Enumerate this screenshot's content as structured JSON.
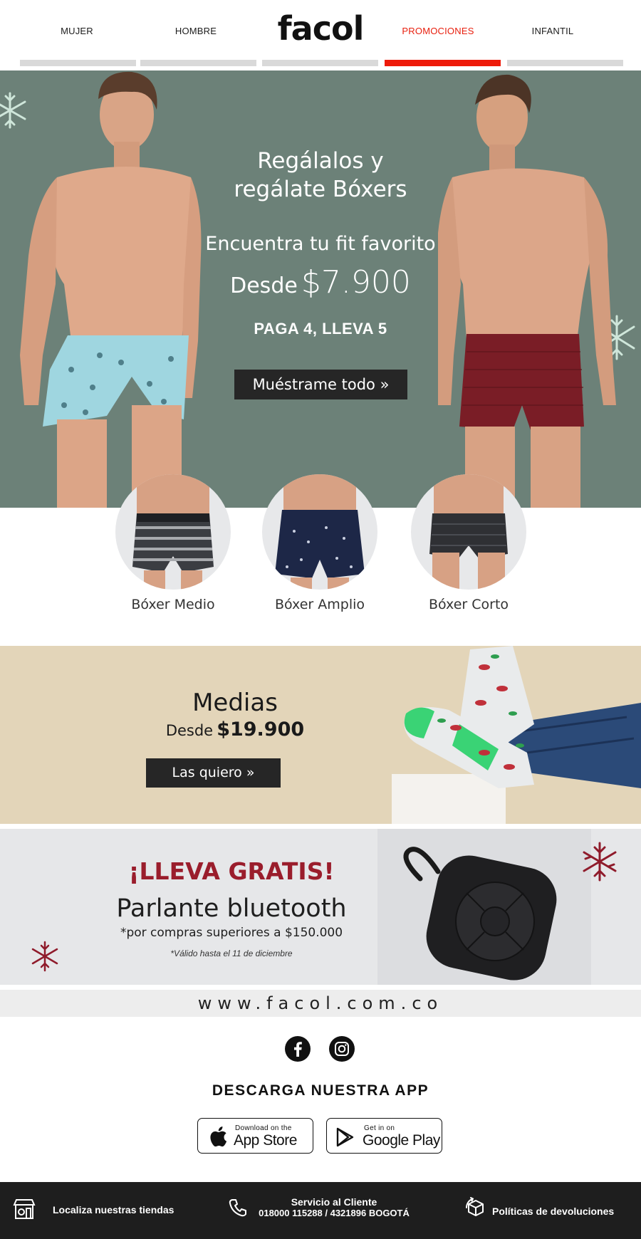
{
  "header": {
    "logo": "facol",
    "nav": [
      {
        "label": "MUJER"
      },
      {
        "label": "HOMBRE"
      },
      {
        "label": "PROMOCIONES"
      },
      {
        "label": "INFANTIL"
      }
    ]
  },
  "hero": {
    "title_line1": "Regálalos y",
    "title_line2": "regálate Bóxers",
    "subtitle": "Encuentra tu fit favorito",
    "price_label": "Desde",
    "price": "$7.900",
    "promo": "PAGA 4, LLEVA 5",
    "cta": "Muéstrame todo »"
  },
  "categories": [
    {
      "label": "Bóxer Medio"
    },
    {
      "label": "Bóxer Amplio"
    },
    {
      "label": "Bóxer Corto"
    }
  ],
  "socks": {
    "title": "Medias",
    "price_label": "Desde",
    "price": "$19.900",
    "cta": "Las quiero »"
  },
  "gift": {
    "headline": "¡LLEVA GRATIS!",
    "product": "Parlante bluetooth",
    "condition": "*por compras superiores a $150.000",
    "validity": "*Válido hasta el 11 de diciembre"
  },
  "footer": {
    "url": "www.facol.com.co",
    "app_heading": "DESCARGA NUESTRA APP",
    "app_store": {
      "small": "Download on the",
      "big": "App Store"
    },
    "google_play": {
      "small": "Get in on",
      "big": "Google Play"
    },
    "stores_link": "Localiza nuestras tiendas",
    "service_title": "Servicio al Cliente",
    "service_phone": "018000 115288 / 4321896 BOGOTÁ",
    "returns_link": "Políticas de devoluciones"
  },
  "colors": {
    "accent_red": "#ee1b0a",
    "hero_bg": "#6c8178",
    "socks_bg": "#e3d5b9",
    "gift_red": "#9a1d2c",
    "footer_bg": "#1e1e1e"
  },
  "icons": [
    "snowflake-icon",
    "facebook-icon",
    "instagram-icon",
    "apple-icon",
    "google-play-icon",
    "store-icon",
    "phone-icon",
    "return-box-icon"
  ]
}
